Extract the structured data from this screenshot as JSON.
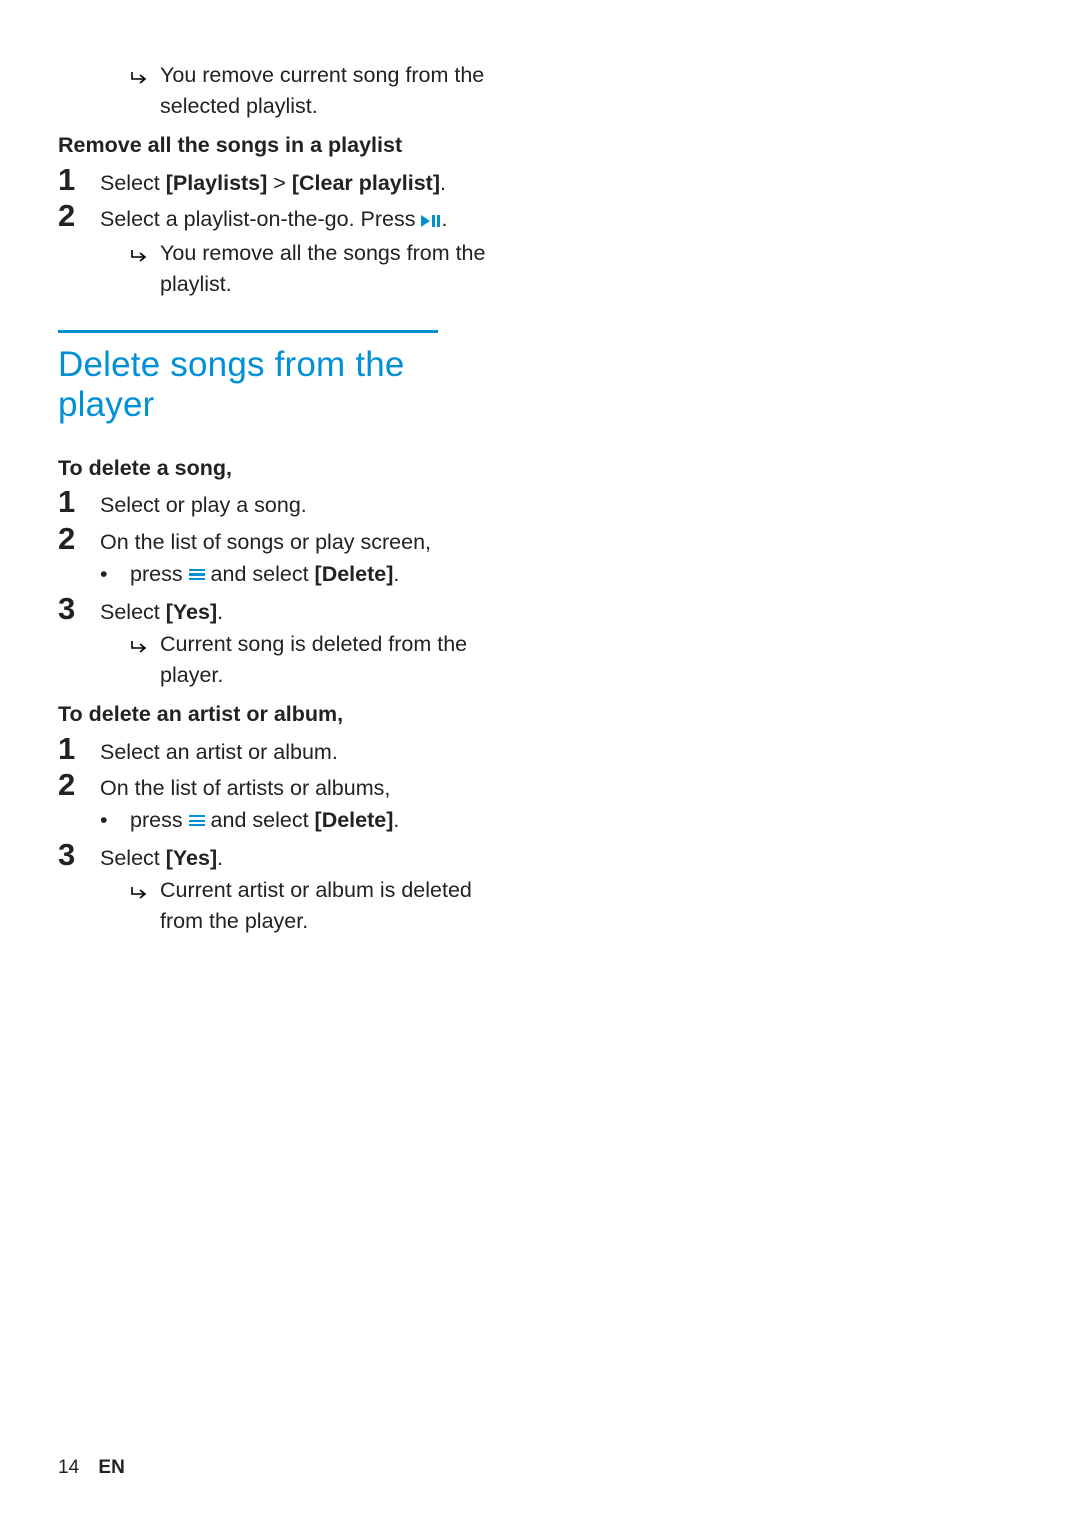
{
  "intro_result": "You remove current song from the selected playlist.",
  "remove_all_heading": "Remove all the songs in a playlist",
  "remove_steps": [
    {
      "num": "1",
      "pre": "Select ",
      "b1": "[Playlists]",
      "mid": " > ",
      "b2": "[Clear playlist]",
      "post": "."
    },
    {
      "num": "2",
      "pre": "Select a playlist-on-the-go. Press ",
      "icon": "playpause",
      "post": "."
    }
  ],
  "remove_result": "You remove all the songs from the playlist.",
  "section_title": "Delete songs from the player",
  "delete_song_heading": "To delete a song,",
  "delete_song_steps": [
    {
      "num": "1",
      "text": "Select or play a song."
    },
    {
      "num": "2",
      "text": "On the list of songs or play screen,"
    }
  ],
  "delete_song_bullet": {
    "pre": "press ",
    "icon": "menu",
    "mid": " and select ",
    "b": "[Delete]",
    "post": "."
  },
  "delete_song_step3": {
    "num": "3",
    "pre": "Select ",
    "b": "[Yes]",
    "post": "."
  },
  "delete_song_result": "Current song is deleted from the player.",
  "delete_album_heading": "To delete an artist or album,",
  "delete_album_steps": [
    {
      "num": "1",
      "text": "Select an artist or album."
    },
    {
      "num": "2",
      "text": "On the list of artists or albums,"
    }
  ],
  "delete_album_bullet": {
    "pre": "press ",
    "icon": "menu",
    "mid": " and select ",
    "b": "[Delete]",
    "post": "."
  },
  "delete_album_step3": {
    "num": "3",
    "pre": "Select ",
    "b": "[Yes]",
    "post": "."
  },
  "delete_album_result": "Current artist or album is deleted from the player.",
  "footer": {
    "page": "14",
    "lang": "EN"
  }
}
